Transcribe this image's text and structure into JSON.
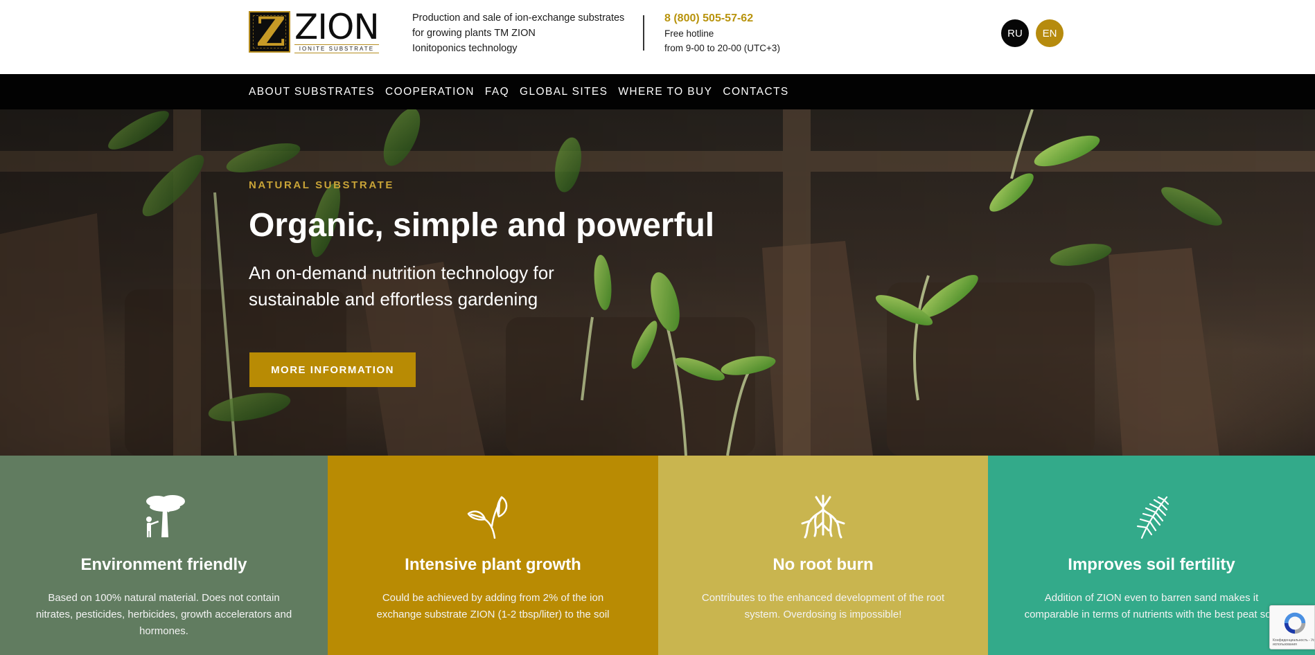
{
  "header": {
    "logo": {
      "word": "ZION",
      "sub": "IONITE SUBSTRATE"
    },
    "tagline": [
      "Production and sale of ion-exchange substrates",
      "for growing plants TM ZION",
      "Ionitoponics technology"
    ],
    "contact": {
      "phone": "8 (800) 505-57-62",
      "line1": "Free hotline",
      "line2": "from 9-00 to 20-00 (UTC+3)"
    },
    "languages": [
      "RU",
      "EN"
    ]
  },
  "nav": {
    "items": [
      "ABOUT SUBSTRATES",
      "COOPERATION",
      "FAQ",
      "GLOBAL SITES",
      "WHERE TO BUY",
      "CONTACTS"
    ]
  },
  "hero": {
    "eyebrow": "NATURAL SUBSTRATE",
    "title": "Organic, simple and powerful",
    "subtitle": "An on-demand nutrition technology for sustainable and effortless gardening",
    "button": "MORE INFORMATION"
  },
  "features": [
    {
      "icon": "tree-icon",
      "title": "Environment friendly",
      "desc": "Based on 100% natural material. Does not contain nitrates, pesticides, herbicides, growth accelerators and hormones.",
      "color": "#617c60"
    },
    {
      "icon": "sprout-icon",
      "title": "Intensive plant growth",
      "desc": "Could be achieved by adding from 2% of the ion exchange substrate ZION (1-2 tbsp/liter) to the soil",
      "color": "#b98b03"
    },
    {
      "icon": "roots-icon",
      "title": "No root burn",
      "desc": "Contributes to the enhanced development of the root system. Overdosing is impossible!",
      "color": "#c9b54f"
    },
    {
      "icon": "fern-icon",
      "title": "Improves soil fertility",
      "desc": "Addition of ZION even to barren sand makes it comparable in terms of nutrients with the best peat soil.",
      "color": "#33aa8a"
    }
  ],
  "recaptcha": {
    "text": "Конфиденциальность - Условия использования"
  },
  "colors": {
    "accent": "#b88b04",
    "nav_bg": "#020202",
    "phone": "#b8930c"
  }
}
